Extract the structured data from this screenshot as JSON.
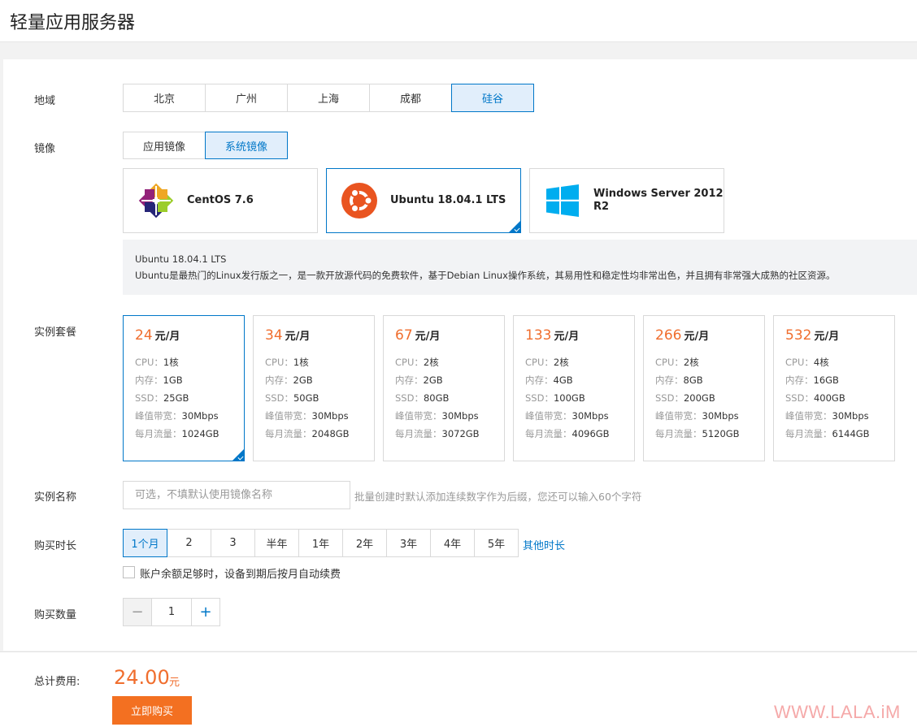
{
  "header": {
    "title": "轻量应用服务器"
  },
  "region": {
    "label": "地域",
    "options": [
      "北京",
      "广州",
      "上海",
      "成都",
      "硅谷"
    ],
    "selected": "硅谷"
  },
  "image": {
    "label": "镜像",
    "types": [
      "应用镜像",
      "系统镜像"
    ],
    "selected_type": "系统镜像",
    "cards": [
      {
        "name": "CentOS 7.6",
        "icon": "centos-logo-icon"
      },
      {
        "name_line1": "Ubuntu 18.04.1 LTS",
        "icon": "ubuntu-logo-icon"
      },
      {
        "name_line1": "Windows Server 2012",
        "name_line2": "R2",
        "icon": "windows-logo-icon"
      }
    ],
    "selected": "Ubuntu 18.04.1 LTS",
    "description_title": "Ubuntu 18.04.1 LTS",
    "description_body": "Ubuntu是最热门的Linux发行版之一，是一款开放源代码的免费软件，基于Debian Linux操作系统，其易用性和稳定性均非常出色，并且拥有非常强大成熟的社区资源。"
  },
  "plans": {
    "label": "实例套餐",
    "unit": "元/月",
    "field_labels": {
      "cpu": "CPU：",
      "mem": "内存：",
      "ssd": "SSD：",
      "bw": "峰值带宽：",
      "traffic": "每月流量："
    },
    "items": [
      {
        "price": "24",
        "cpu": "1核",
        "mem": "1GB",
        "ssd": "25GB",
        "bw": "30Mbps",
        "traffic": "1024GB"
      },
      {
        "price": "34",
        "cpu": "1核",
        "mem": "2GB",
        "ssd": "50GB",
        "bw": "30Mbps",
        "traffic": "2048GB"
      },
      {
        "price": "67",
        "cpu": "2核",
        "mem": "2GB",
        "ssd": "80GB",
        "bw": "30Mbps",
        "traffic": "3072GB"
      },
      {
        "price": "133",
        "cpu": "2核",
        "mem": "4GB",
        "ssd": "100GB",
        "bw": "30Mbps",
        "traffic": "4096GB"
      },
      {
        "price": "266",
        "cpu": "2核",
        "mem": "8GB",
        "ssd": "200GB",
        "bw": "30Mbps",
        "traffic": "5120GB"
      },
      {
        "price": "532",
        "cpu": "4核",
        "mem": "16GB",
        "ssd": "400GB",
        "bw": "30Mbps",
        "traffic": "6144GB"
      }
    ],
    "selected": "24"
  },
  "instance_name": {
    "label": "实例名称",
    "placeholder": "可选，不填默认使用镜像名称",
    "value": "",
    "hint": "批量创建时默认添加连续数字作为后缀，您还可以输入60个字符"
  },
  "duration": {
    "label": "购买时长",
    "options": [
      "1个月",
      "2",
      "3",
      "半年",
      "1年",
      "2年",
      "3年",
      "4年",
      "5年"
    ],
    "selected": "1个月",
    "other_link": "其他时长",
    "auto_renew_label": "账户余额足够时，设备到期后按月自动续费",
    "auto_renew_checked": false
  },
  "quantity": {
    "label": "购买数量",
    "minus": "−",
    "plus": "+",
    "value": "1"
  },
  "footer": {
    "total_label": "总计费用:",
    "total_price": "24.00",
    "total_unit": "元",
    "buy_button": "立即购买"
  },
  "watermark": "WWW.LALA.iM",
  "colors": {
    "accent": "#0077c8",
    "price": "#f06e2e",
    "buy": "#f37021"
  }
}
